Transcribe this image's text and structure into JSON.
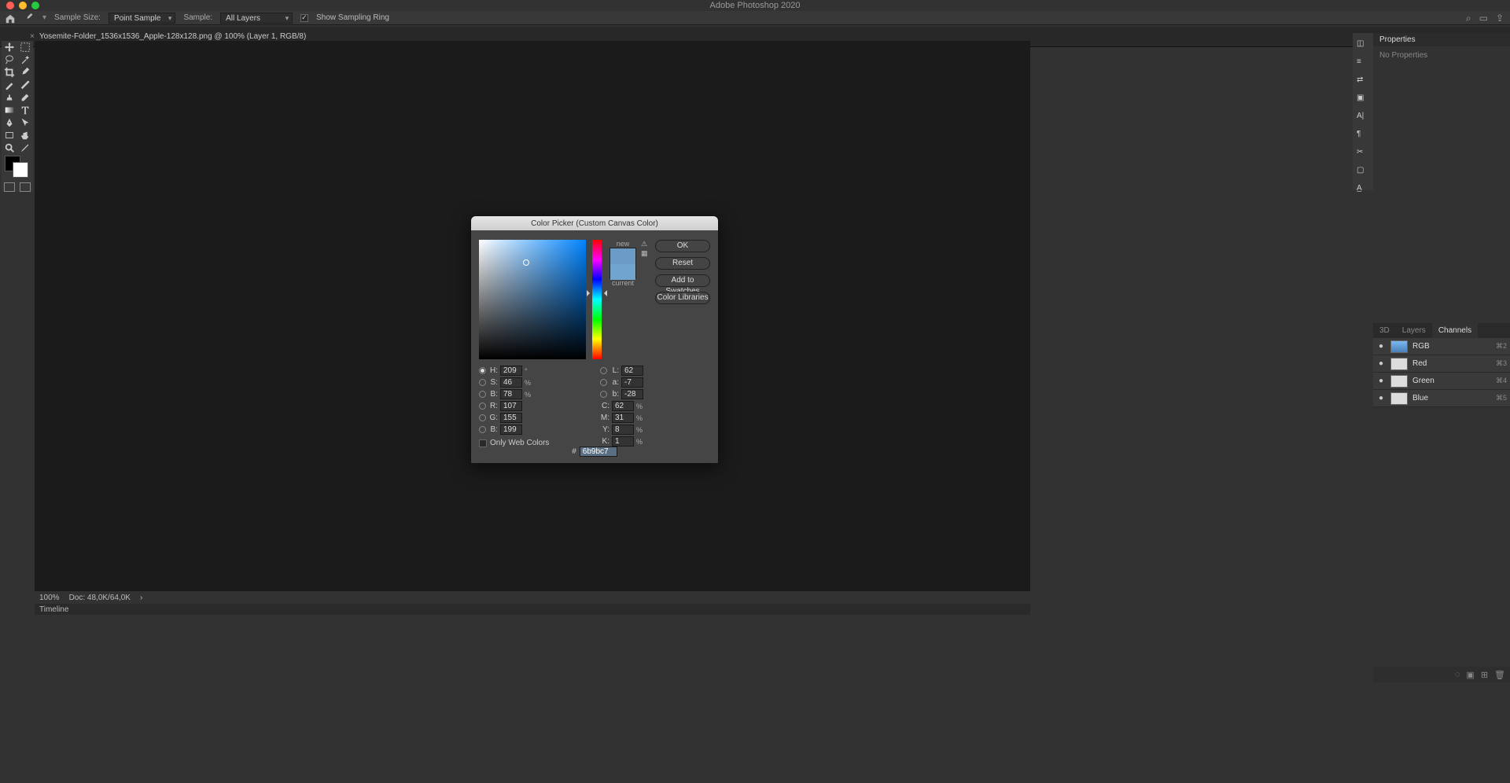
{
  "app": {
    "title": "Adobe Photoshop 2020"
  },
  "options_bar": {
    "sample_size_label": "Sample Size:",
    "sample_size_value": "Point Sample",
    "sample_label": "Sample:",
    "sample_value": "All Layers",
    "show_ring_label": "Show Sampling Ring"
  },
  "document": {
    "tab_label": "Yosemite-Folder_1536x1536_Apple-128x128.png @ 100% (Layer 1, RGB/8)"
  },
  "properties": {
    "title": "Properties",
    "body": "No Properties"
  },
  "panel_tabs": {
    "t3d": "3D",
    "layers": "Layers",
    "channels": "Channels"
  },
  "channels": [
    {
      "name": "RGB",
      "key": "⌘2",
      "thumb": "rgb"
    },
    {
      "name": "Red",
      "key": "⌘3",
      "thumb": ""
    },
    {
      "name": "Green",
      "key": "⌘4",
      "thumb": ""
    },
    {
      "name": "Blue",
      "key": "⌘5",
      "thumb": ""
    }
  ],
  "status": {
    "zoom": "100%",
    "docsize": "Doc: 48,0K/64,0K"
  },
  "timeline": {
    "label": "Timeline"
  },
  "color_picker": {
    "title": "Color Picker (Custom Canvas Color)",
    "new_label": "new",
    "current_label": "current",
    "btn_ok": "OK",
    "btn_reset": "Reset",
    "btn_add": "Add to Swatches",
    "btn_lib": "Color Libraries",
    "only_web": "Only Web Colors",
    "values": {
      "H": "209",
      "S": "46",
      "Bv": "78",
      "L": "62",
      "a": "-7",
      "b": "-28",
      "R": "107",
      "G": "155",
      "Bch": "199",
      "C": "62",
      "M": "31",
      "Y": "8",
      "K": "1",
      "hex": "6b9bc7"
    },
    "units": {
      "deg": "°",
      "pct": "%"
    },
    "labels": {
      "H": "H:",
      "S": "S:",
      "Bv": "B:",
      "L": "L:",
      "a": "a:",
      "b": "b:",
      "R": "R:",
      "G": "G:",
      "Bch": "B:",
      "C": "C:",
      "M": "M:",
      "Y": "Y:",
      "K": "K:",
      "hash": "#"
    }
  }
}
